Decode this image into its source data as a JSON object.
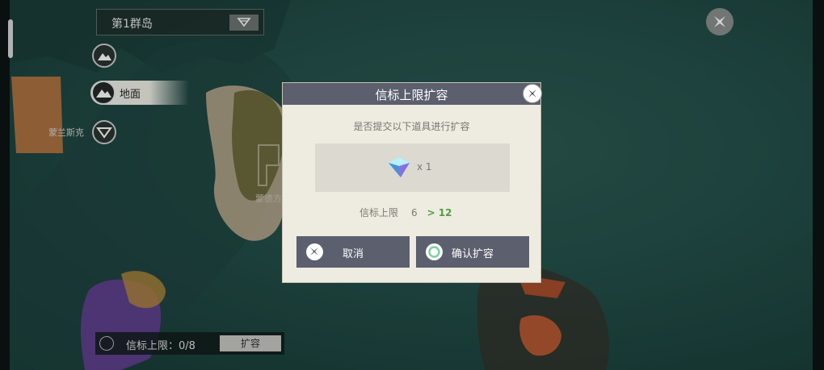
{
  "region_selector": {
    "label": "第1群岛"
  },
  "layers": {
    "active_label": "地面"
  },
  "map": {
    "poi_label_left": "蒙兰斯克",
    "poi_label_center": "蒙德方"
  },
  "bottom_bar": {
    "beacon_limit_text": "信标上限：0/8",
    "expand_button": "扩容"
  },
  "dialog": {
    "title": "信标上限扩容",
    "prompt": "是否提交以下道具进行扩容",
    "item": {
      "icon": "crystal-item-icon",
      "quantity": "x 1"
    },
    "limit_label": "信标上限",
    "limit_old": "6",
    "limit_arrow": ">",
    "limit_new": "12",
    "cancel_button": "取消",
    "confirm_button": "确认扩容"
  },
  "colors": {
    "dialog_header": "#5b5f6e",
    "increase_green": "#4e9e3c"
  }
}
